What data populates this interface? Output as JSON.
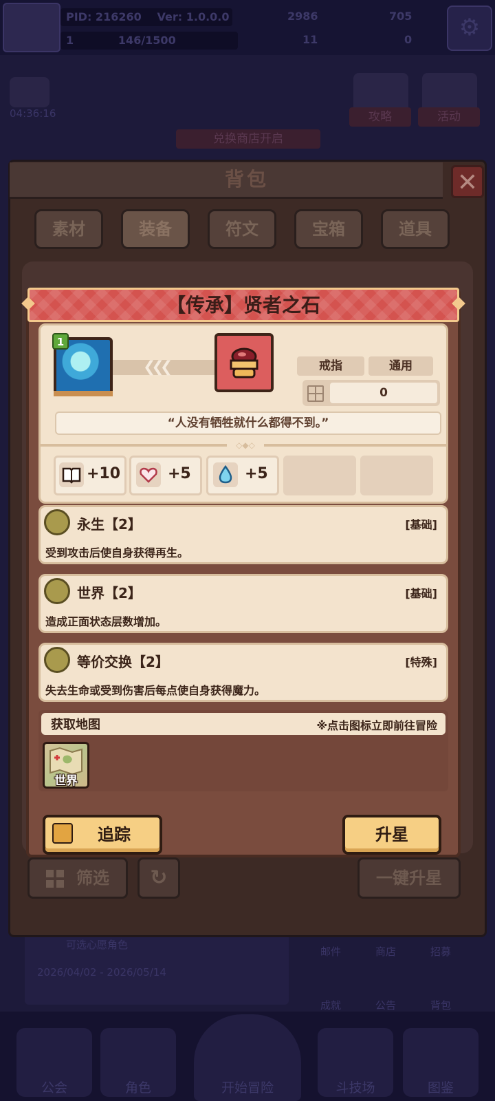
{
  "background": {
    "pid": "PID: 216260",
    "version": "Ver: 1.0.0.0",
    "currency_a": "2986",
    "currency_b": "705",
    "level": "1",
    "exp": "146/1500",
    "currency_c": "11",
    "currency_d": "0",
    "timer": "04:36:16",
    "guide_label": "攻略",
    "event_label": "活动",
    "shop_notice": "兑换商店开启",
    "banner_subtitle": "可选心愿角色",
    "banner_dates": "2026/04/02 - 2026/05/14",
    "side_menu": [
      "邮件",
      "商店",
      "招募",
      "成就",
      "公告",
      "背包"
    ],
    "bottom_nav": [
      "公会",
      "角色",
      "开始冒险",
      "斗技场",
      "图鉴"
    ]
  },
  "bag": {
    "title": "背包",
    "tabs": [
      "素材",
      "装备",
      "符文",
      "宝箱",
      "道具"
    ],
    "active_tab": 1,
    "filter_label": "筛选",
    "upgrade_all_label": "一键升星"
  },
  "item": {
    "title": "【传承】贤者之石",
    "level_badge": "1",
    "type_tag": "戒指",
    "usage_tag": "通用",
    "count": "0",
    "quote": "“人没有牺牲就什么都得不到。”",
    "stats": [
      {
        "icon": "book-icon",
        "value": "+10"
      },
      {
        "icon": "heart-icon",
        "value": "+5"
      },
      {
        "icon": "water-drop-icon",
        "value": "+5"
      }
    ],
    "effects": [
      {
        "name": "永生【2】",
        "type": "[基础]",
        "desc": "受到攻击后使自身获得再生。"
      },
      {
        "name": "世界【2】",
        "type": "[基础]",
        "desc": "造成正面状态层数增加。"
      },
      {
        "name": "等价交换【2】",
        "type": "[特殊]",
        "desc": "失去生命或受到伤害后每点使自身获得魔力。"
      }
    ],
    "map_title": "获取地图",
    "map_hint": "※点击图标立即前往冒险",
    "map_name": "世界",
    "track_label": "追踪",
    "star_up_label": "升星"
  },
  "colors": {
    "header_red": "#d4534f",
    "card_cream": "#f3e3cd",
    "button_gold": "#f6cf84",
    "popup_brown": "#7a4c3e"
  }
}
